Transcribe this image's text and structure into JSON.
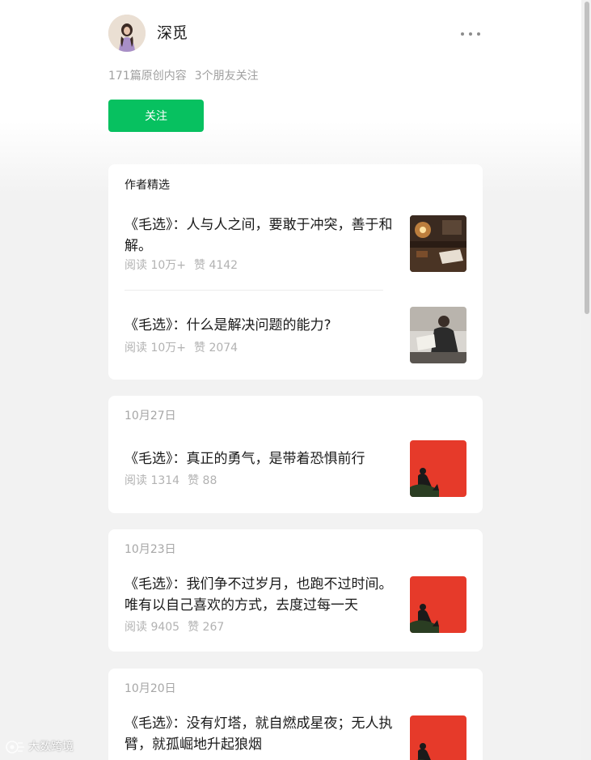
{
  "profile": {
    "name": "深觅",
    "avatar_icon": "avatar-girl-icon",
    "stats": [
      "171篇原创内容",
      "3个朋友关注"
    ],
    "follow_label": "关注",
    "accent_color": "#07c160"
  },
  "featured": {
    "header": "作者精选",
    "articles": [
      {
        "title": "《毛选》：人与人之间，要敢于冲突，善于和解。",
        "read": "阅读 10万+",
        "like": "赞 4142"
      },
      {
        "title": "《毛选》：什么是解决问题的能力?",
        "read": "阅读 10万+",
        "like": "赞 2074"
      }
    ]
  },
  "feed": [
    {
      "date": "10月27日",
      "title": "《毛选》：真正的勇气，是带着恐惧前行",
      "read": "阅读 1314",
      "like": "赞 88"
    },
    {
      "date": "10月23日",
      "title": "《毛选》：我们争不过岁月，也跑不过时间。唯有以自己喜欢的方式，去度过每一天",
      "read": "阅读 9405",
      "like": "赞 267"
    },
    {
      "date": "10月20日",
      "title": "《毛选》：没有灯塔，就自燃成星夜；无人执臂，就孤崛地升起狼烟",
      "read": "",
      "like": ""
    }
  ],
  "watermark": "大数跨境"
}
